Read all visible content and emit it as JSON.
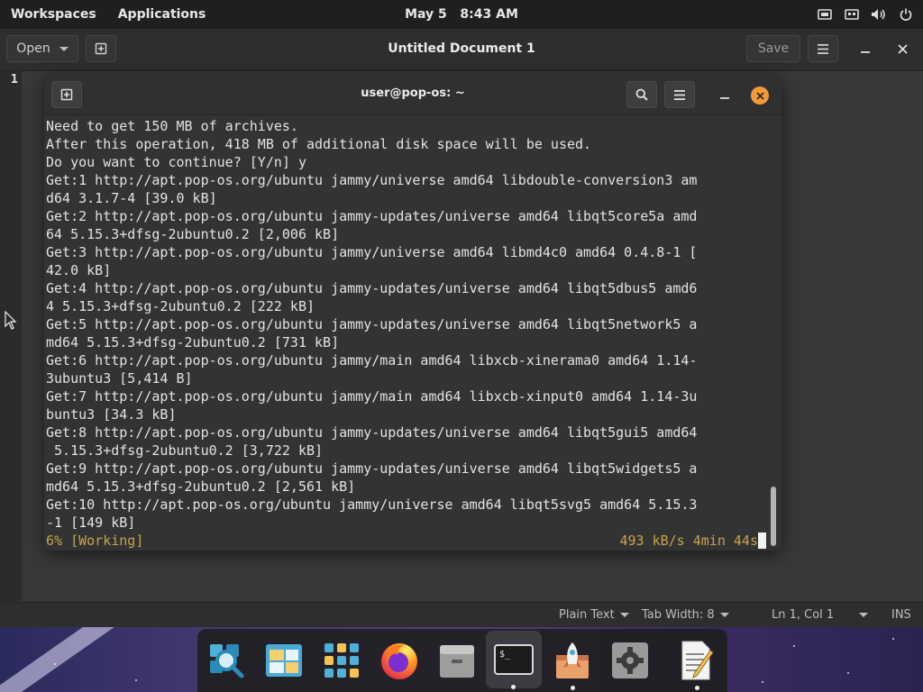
{
  "topbar": {
    "workspaces": "Workspaces",
    "applications": "Applications",
    "clock": "May 5   8:43 AM",
    "tray_icons": [
      "screenshot-icon",
      "network-wired-icon",
      "volume-icon",
      "power-icon"
    ]
  },
  "editor": {
    "open_label": "Open",
    "title": "Untitled Document 1",
    "save_label": "Save",
    "line_number": "1",
    "status": {
      "language": "Plain Text",
      "tab_width": "Tab Width: 8",
      "position": "Ln 1, Col 1",
      "mode": "INS"
    }
  },
  "terminal": {
    "title": "user@pop-os: ~",
    "lines": [
      "Need to get 150 MB of archives.",
      "After this operation, 418 MB of additional disk space will be used.",
      "Do you want to continue? [Y/n] y",
      "Get:1 http://apt.pop-os.org/ubuntu jammy/universe amd64 libdouble-conversion3 am",
      "d64 3.1.7-4 [39.0 kB]",
      "Get:2 http://apt.pop-os.org/ubuntu jammy-updates/universe amd64 libqt5core5a amd",
      "64 5.15.3+dfsg-2ubuntu0.2 [2,006 kB]",
      "Get:3 http://apt.pop-os.org/ubuntu jammy/universe amd64 libmd4c0 amd64 0.4.8-1 [",
      "42.0 kB]",
      "Get:4 http://apt.pop-os.org/ubuntu jammy-updates/universe amd64 libqt5dbus5 amd6",
      "4 5.15.3+dfsg-2ubuntu0.2 [222 kB]",
      "Get:5 http://apt.pop-os.org/ubuntu jammy-updates/universe amd64 libqt5network5 a",
      "md64 5.15.3+dfsg-2ubuntu0.2 [731 kB]",
      "Get:6 http://apt.pop-os.org/ubuntu jammy/main amd64 libxcb-xinerama0 amd64 1.14-",
      "3ubuntu3 [5,414 B]",
      "Get:7 http://apt.pop-os.org/ubuntu jammy/main amd64 libxcb-xinput0 amd64 1.14-3u",
      "buntu3 [34.3 kB]",
      "Get:8 http://apt.pop-os.org/ubuntu jammy-updates/universe amd64 libqt5gui5 amd64",
      " 5.15.3+dfsg-2ubuntu0.2 [3,722 kB]",
      "Get:9 http://apt.pop-os.org/ubuntu jammy-updates/universe amd64 libqt5widgets5 a",
      "md64 5.15.3+dfsg-2ubuntu0.2 [2,561 kB]",
      "Get:10 http://apt.pop-os.org/ubuntu jammy/universe amd64 libqt5svg5 amd64 5.15.3",
      "-1 [149 kB]"
    ],
    "progress_left": "6% [Working]",
    "progress_right": "493 kB/s 4min 44s"
  },
  "dock": {
    "items": [
      {
        "name": "search-app",
        "icon": "magnifier-icon",
        "running": false
      },
      {
        "name": "workspaces-app",
        "icon": "workspaces-icon",
        "running": false
      },
      {
        "name": "app-grid",
        "icon": "app-grid-icon",
        "running": false
      },
      {
        "name": "firefox",
        "icon": "firefox-icon",
        "running": false
      },
      {
        "name": "files",
        "icon": "file-cabinet-icon",
        "running": false
      },
      {
        "name": "terminal",
        "icon": "terminal-icon",
        "running": true,
        "active": true
      },
      {
        "name": "pop-shop",
        "icon": "rocket-shop-icon",
        "running": true
      },
      {
        "name": "settings",
        "icon": "gear-icon",
        "running": false
      },
      {
        "name": "text-editor",
        "icon": "text-editor-icon",
        "running": true
      }
    ]
  },
  "colors": {
    "accent_orange": "#f39a3b",
    "progress_text": "#c7a34d",
    "panel": "#1f1f1f"
  }
}
